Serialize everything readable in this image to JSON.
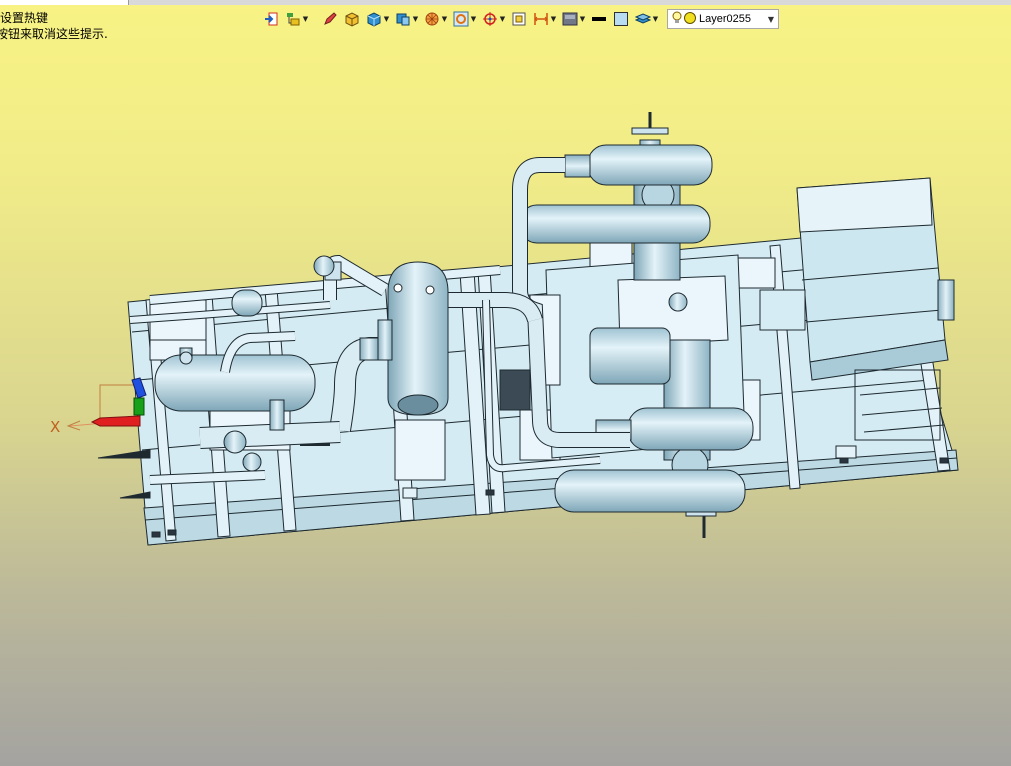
{
  "hint": {
    "line1": "设置热键",
    "line2": "按钮来取消这些提示."
  },
  "toolbar": {
    "layer_name": "Layer0255",
    "items": [
      {
        "name": "insert-icon",
        "has_dropdown": false
      },
      {
        "name": "tree-filter-icon",
        "has_dropdown": true
      },
      {
        "name": "pencil-icon",
        "has_dropdown": false
      },
      {
        "name": "box-solid-icon",
        "has_dropdown": false
      },
      {
        "name": "cube-icon",
        "has_dropdown": true
      },
      {
        "name": "view-cube-icon",
        "has_dropdown": true
      },
      {
        "name": "render-sphere-icon",
        "has_dropdown": true
      },
      {
        "name": "zoom-icon",
        "has_dropdown": true
      },
      {
        "name": "target-icon",
        "has_dropdown": true
      },
      {
        "name": "frame-icon",
        "has_dropdown": false
      },
      {
        "name": "dimension-icon",
        "has_dropdown": true
      },
      {
        "name": "display-mode-icon",
        "has_dropdown": true
      },
      {
        "name": "line-color-icon",
        "has_dropdown": false
      },
      {
        "name": "fill-color-icon",
        "has_dropdown": false
      },
      {
        "name": "layers-icon",
        "has_dropdown": true
      }
    ]
  },
  "axis": {
    "x_label": "X"
  },
  "colors": {
    "bg_top": "#f8f384",
    "bg_bottom": "#a4a3a0",
    "model_fill": "#c9e3ee",
    "model_edge": "#1e2a30",
    "axis_x": "#e02020",
    "axis_y": "#18a018"
  }
}
